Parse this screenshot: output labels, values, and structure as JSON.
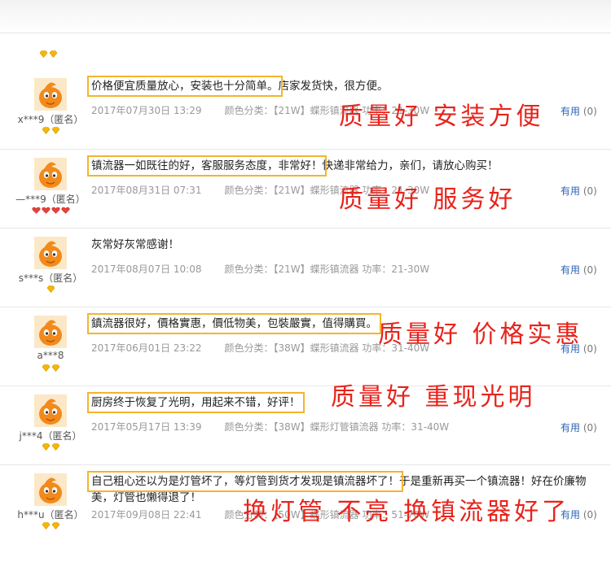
{
  "reviews": [
    {
      "user": "x***9（匿名）",
      "badge": [
        "gold",
        "gold"
      ],
      "text_hl": "价格便宜质量放心，安装也十分简单。",
      "text_rest": "店家发货快，很方便。",
      "date": "2017年07月30日 13:29",
      "spec": "颜色分类：【21W】蝶形镇流器  功率：21-30W",
      "useful_label": "有用",
      "useful_count": "(0)",
      "stamp": "质量好 安装方便"
    },
    {
      "user": "—***9（匿名）",
      "badge": [
        "red",
        "red",
        "red",
        "red"
      ],
      "text_hl": "镇流器一如既往的好，客服服务态度，非常好！",
      "text_rest": "快递非常给力，亲们，请放心购买！",
      "date": "2017年08月31日 07:31",
      "spec": "颜色分类：【21W】蝶形镇流器  功率：21-30W",
      "useful_label": "有用",
      "useful_count": "(0)",
      "stamp": "质量好 服务好"
    },
    {
      "user": "s***s（匿名）",
      "badge": [
        "gold"
      ],
      "text_hl": "",
      "text_rest": "灰常好灰常感谢！",
      "date": "2017年08月07日 10:08",
      "spec": "颜色分类：【21W】蝶形镇流器  功率：21-30W",
      "useful_label": "有用",
      "useful_count": "(0)",
      "stamp": ""
    },
    {
      "user": "a***8",
      "badge": [
        "gold",
        "gold"
      ],
      "text_hl": "鎮流器很好，價格實惠，價低物美，包裝嚴實，值得購買。",
      "text_rest": "",
      "date": "2017年06月01日 23:22",
      "spec": "颜色分类：【38W】蝶形镇流器  功率：31-40W",
      "useful_label": "有用",
      "useful_count": "(0)",
      "stamp": "质量好 价格实惠"
    },
    {
      "user": "j***4（匿名）",
      "badge": [
        "gold",
        "gold"
      ],
      "text_hl": "厨房终于恢复了光明，用起来不错，好评！",
      "text_rest": "",
      "date": "2017年05月17日 13:39",
      "spec": "颜色分类：【38W】蝶形灯管镇流器  功率：31-40W",
      "useful_label": "有用",
      "useful_count": "(0)",
      "stamp": "质量好 重现光明"
    },
    {
      "user": "h***u（匿名）",
      "badge": [
        "gold",
        "gold"
      ],
      "text_hl": "自己粗心还以为是灯管坏了，等灯管到货才发现是镇流器坏了！",
      "text_rest": "于是重新再买一个镇流器！好在价廉物美，灯管也懒得退了！",
      "date": "2017年09月08日 22:41",
      "spec": "颜色分类：【50W】蝶形镇流器  功率：51-70W",
      "useful_label": "有用",
      "useful_count": "(0)",
      "stamp": "换灯管 不亮 换镇流器好了"
    }
  ],
  "colors": {
    "accent_outline": "#f3b52d",
    "stamp": "#e8231b",
    "link": "#2b63b8",
    "gold_badge": "#f5b800",
    "red_badge": "#e8413a"
  }
}
